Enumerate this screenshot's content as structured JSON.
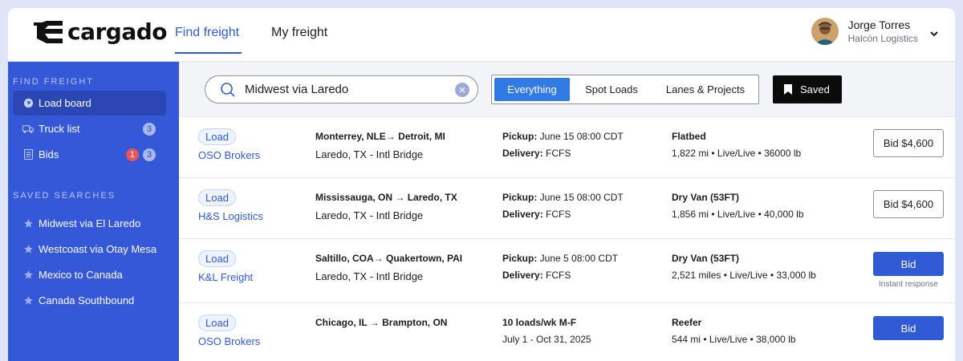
{
  "app": {
    "logo_text": "cargado",
    "nav": [
      {
        "label": "Find freight"
      },
      {
        "label": "My freight"
      }
    ]
  },
  "user": {
    "name": "Jorge Torres",
    "org": "Halcón Logistics"
  },
  "sidebar": {
    "find_heading": "FIND FREIGHT",
    "items": [
      {
        "label": "Load board",
        "icon": "globe-icon"
      },
      {
        "label": "Truck list",
        "icon": "truck-icon",
        "badge": "3"
      },
      {
        "label": "Bids",
        "icon": "document-icon",
        "badge_alert": "1",
        "badge": "3"
      }
    ],
    "saved_heading": "SAVED SEARCHES",
    "saved": [
      {
        "label": "Midwest via El Laredo"
      },
      {
        "label": "Westcoast via Otay Mesa"
      },
      {
        "label": "Mexico to Canada"
      },
      {
        "label": "Canada Southbound"
      }
    ]
  },
  "toolbar": {
    "search_value": "Midwest via Laredo",
    "segments": [
      {
        "label": "Everything"
      },
      {
        "label": "Spot Loads"
      },
      {
        "label": "Lanes & Projects"
      }
    ],
    "saved_label": "Saved"
  },
  "rows": [
    {
      "tag": "Load",
      "broker": "OSO Brokers",
      "route": "Monterrey, NLE→ Detroit, MI",
      "crossing": "Laredo, TX - Intl Bridge",
      "s1_label": "Pickup:",
      "s1_value": " June 15 08:00 CDT",
      "s2_label": "Delivery:",
      "s2_value": " FCFS",
      "equipment": "Flatbed",
      "details": "1,822 mi • Live/Live • 36000 lb",
      "bid": "Bid $4,600"
    },
    {
      "tag": "Load",
      "broker": "H&S Logistics",
      "route": "Mississauga, ON → Laredo, TX",
      "crossing": "Laredo, TX - Intl Bridge",
      "s1_label": "Pickup:",
      "s1_value": " June 15 08:00 CDT",
      "s2_label": "Delivery:",
      "s2_value": " FCFS",
      "equipment": "Dry Van (53FT)",
      "details": "1,856 mi • Live/Live • 40,000 lb",
      "bid": "Bid $4,600"
    },
    {
      "tag": "Load",
      "broker": "K&L Freight",
      "route": "Saltillo, COA→ Quakertown, PAI",
      "crossing": "Laredo, TX - Intl Bridge",
      "s1_label": "Pickup:",
      "s1_value": " June 5 08:00 CDT",
      "s2_label": "Delivery:",
      "s2_value": " FCFS",
      "equipment": "Dry Van (53FT)",
      "details": "2,521 miles • Live/Live • 33,000 lb",
      "bid": "Bid",
      "bid_note": "Instant response"
    },
    {
      "tag": "Load",
      "broker": "OSO Brokers",
      "route": "Chicago, IL → Brampton, ON",
      "crossing": "",
      "s1_label": "10 loads/wk M-F",
      "s1_value": "",
      "s2_label": "",
      "s2_value": "July 1 - Oct 31, 2025",
      "equipment": "Reefer",
      "details": "544 mi • Live/Live • 38,000 lb",
      "bid": "Bid"
    }
  ],
  "colors": {
    "accent": "#2f5bd3",
    "sidebar": "#3558d8",
    "segment_active": "#2f7be3",
    "alert": "#e65656"
  }
}
